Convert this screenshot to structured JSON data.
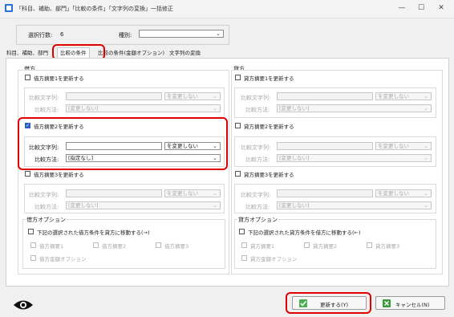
{
  "window": {
    "title": "「科目、補助、部門」「比較の条件」「文字列の変換」一括修正",
    "buttons": {
      "minimize": "—",
      "maximize": "☐",
      "close": "✕"
    }
  },
  "top": {
    "selected_count_label": "選択行数:",
    "selected_count": "6",
    "type_label": "種別:",
    "type_value": ""
  },
  "tabs": [
    {
      "label": "科目、補助、部門"
    },
    {
      "label": "比較の条件"
    },
    {
      "label": "比較の条件(金額オプション)"
    },
    {
      "label": "文字列の変換"
    }
  ],
  "debit": {
    "title": "借方",
    "groups": [
      {
        "checkbox_label": "借方摘要1を更新する",
        "checked": false,
        "compare_text_label": "比較文字列:",
        "compare_text": "",
        "mode_value": "を変更しない",
        "method_label": "比較方法:",
        "method_value": "[変更しない]"
      },
      {
        "checkbox_label": "借方摘要2を更新する",
        "checked": true,
        "compare_text_label": "比較文字列:",
        "compare_text": "",
        "mode_value": "を変更しない",
        "method_label": "比較方法:",
        "method_value": "[指定なし]"
      },
      {
        "checkbox_label": "借方摘要3を更新する",
        "checked": false,
        "compare_text_label": "比較文字列:",
        "compare_text": "",
        "mode_value": "を変更しない",
        "method_label": "比較方法:",
        "method_value": "[変更しない]"
      }
    ],
    "options": {
      "title": "借方オプション",
      "move_label": "下記の選択された借方条件を貸方に移動する(→)",
      "items": [
        "借方摘要1",
        "借方摘要2",
        "借方摘要3",
        "借方金額オプション"
      ]
    }
  },
  "credit": {
    "title": "貸方",
    "groups": [
      {
        "checkbox_label": "貸方摘要1を更新する",
        "checked": false,
        "compare_text_label": "比較文字列:",
        "compare_text": "",
        "mode_value": "を変更しない",
        "method_label": "比較方法:",
        "method_value": "[変更しない]"
      },
      {
        "checkbox_label": "貸方摘要2を更新する",
        "checked": false,
        "compare_text_label": "比較文字列:",
        "compare_text": "",
        "mode_value": "を変更しない",
        "method_label": "比較方法:",
        "method_value": "[変更しない]"
      },
      {
        "checkbox_label": "貸方摘要3を更新する",
        "checked": false,
        "compare_text_label": "比較文字列:",
        "compare_text": "",
        "mode_value": "を変更しない",
        "method_label": "比較方法:",
        "method_value": "[変更しない]"
      }
    ],
    "options": {
      "title": "貸方オプション",
      "move_label": "下記の選択された貸方条件を借方に移動する(←)",
      "items": [
        "貸方摘要1",
        "貸方摘要2",
        "貸方摘要3",
        "貸方金額オプション"
      ]
    }
  },
  "footer": {
    "update_button": "更新する(Y)",
    "cancel_button": "キャンセル(N)"
  },
  "colors": {
    "accent": "#2b5fc4",
    "highlight": "#e00000",
    "ok_icon": "#4caf50",
    "cancel_icon": "#3a9a3a"
  }
}
